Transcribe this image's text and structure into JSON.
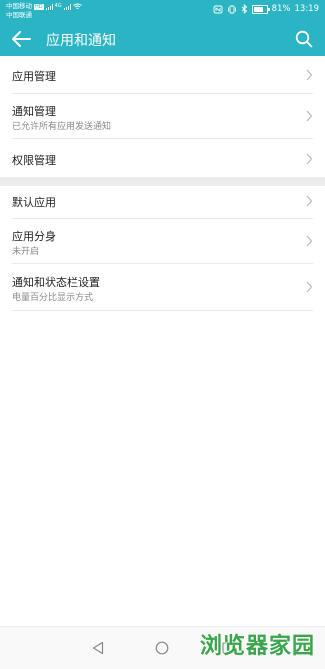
{
  "status_bar": {
    "carrier1": "中国移动",
    "carrier1_badge": "HD",
    "carrier2": "中国联通",
    "net_label": "4G",
    "battery": "81%",
    "battery_level": 0.81,
    "time": "13:19"
  },
  "app_bar": {
    "title": "应用和通知"
  },
  "group1": [
    {
      "title": "应用管理"
    },
    {
      "title": "通知管理",
      "subtitle": "已允许所有应用发送通知"
    },
    {
      "title": "权限管理"
    }
  ],
  "group2": [
    {
      "title": "默认应用"
    },
    {
      "title": "应用分身",
      "subtitle": "未开启"
    },
    {
      "title": "通知和状态栏设置",
      "subtitle": "电量百分比显示方式"
    }
  ],
  "watermark": "浏览器家园",
  "colors": {
    "accent": "#2bb4c3",
    "watermark": "#3aa54a"
  }
}
